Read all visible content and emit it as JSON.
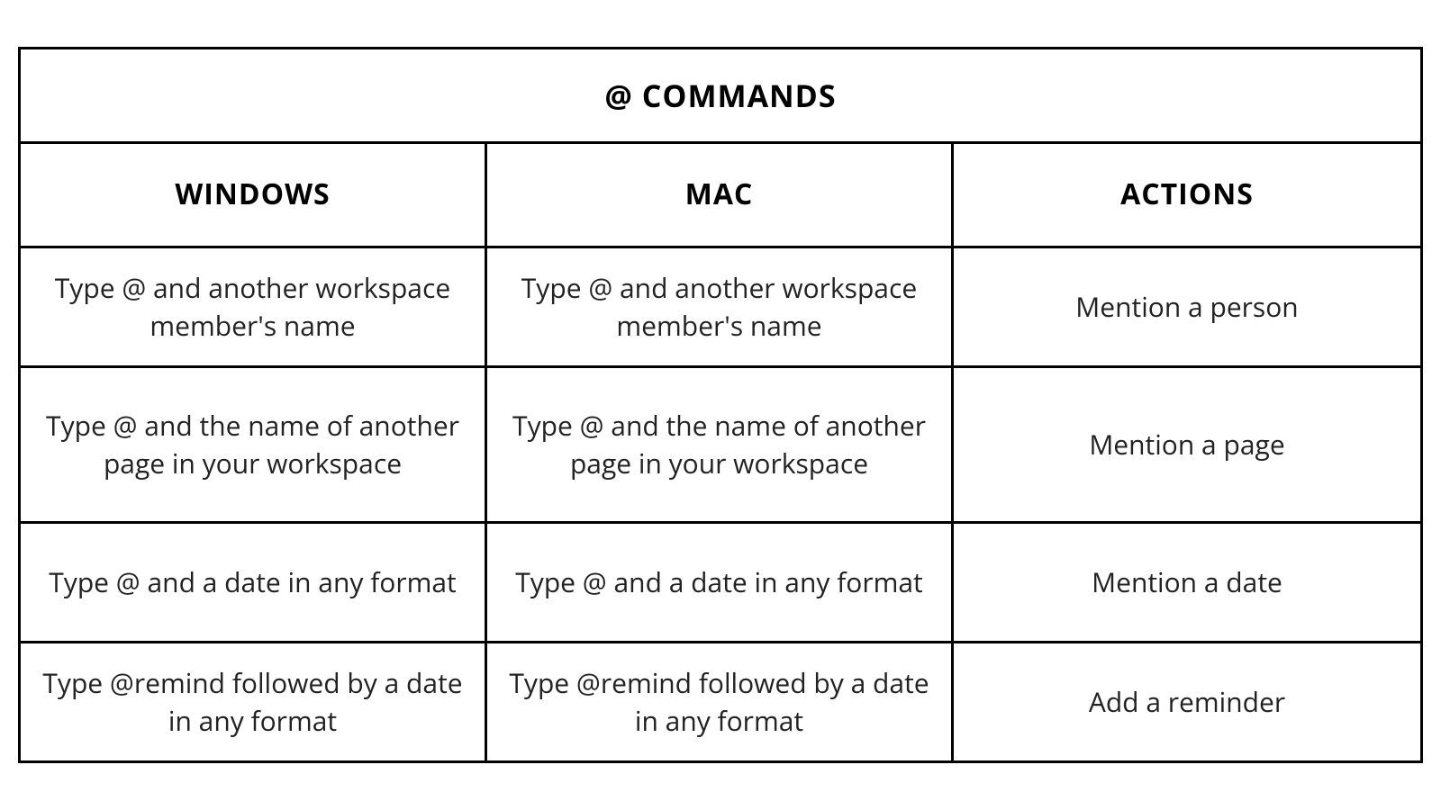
{
  "title": "@ COMMANDS",
  "columns": {
    "windows": "WINDOWS",
    "mac": "MAC",
    "actions": "ACTIONS"
  },
  "rows": [
    {
      "windows": "Type @ and another workspace member's name",
      "mac": "Type @ and another workspace member's name",
      "action": "Mention a person"
    },
    {
      "windows": "Type @ and the name of another page in your workspace",
      "mac": "Type @ and the name of another page in your workspace",
      "action": "Mention a page"
    },
    {
      "windows": "Type @ and a date in any format",
      "mac": "Type @ and a date in any format",
      "action": "Mention a date"
    },
    {
      "windows": "Type @remind followed by a date in any format",
      "mac": "Type @remind followed by a date in any format",
      "action": "Add a reminder"
    }
  ]
}
